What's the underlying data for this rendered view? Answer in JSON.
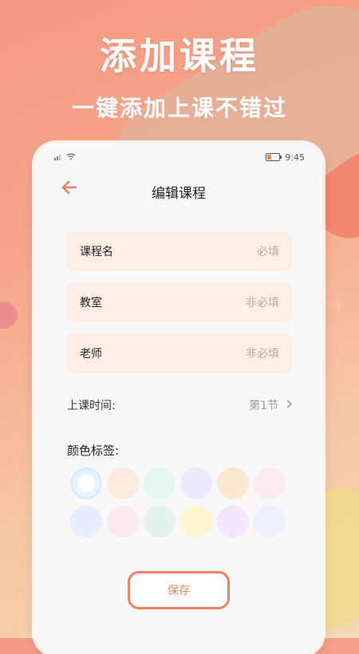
{
  "promo": {
    "headline": "添加课程",
    "subline": "一键添加上课不错过"
  },
  "status_bar": {
    "time": "9:45"
  },
  "navbar": {
    "title": "编辑课程",
    "back_icon": "arrow-left-icon"
  },
  "form": {
    "fields": [
      {
        "label": "课程名",
        "placeholder": "必填"
      },
      {
        "label": "教室",
        "placeholder": "非必填"
      },
      {
        "label": "老师",
        "placeholder": "非必填"
      }
    ],
    "class_time": {
      "label": "上课时间:",
      "value": "第1节",
      "icon": "chevron-right-icon"
    },
    "color_label": "颜色标签:",
    "swatches": [
      "#e9f3ff",
      "#fbeadd",
      "#e3f6f1",
      "#eceaff",
      "#fbe8cf",
      "#fdecef",
      "#e6edff",
      "#fbe9f1",
      "#e3f3ec",
      "#fdf5cf",
      "#f4e7fb",
      "#eef0fb"
    ],
    "selected_swatch": 0
  },
  "save_button": {
    "label": "保存"
  },
  "colors": {
    "accent": "#f47f5e",
    "field_bg": "#fdeee6"
  }
}
